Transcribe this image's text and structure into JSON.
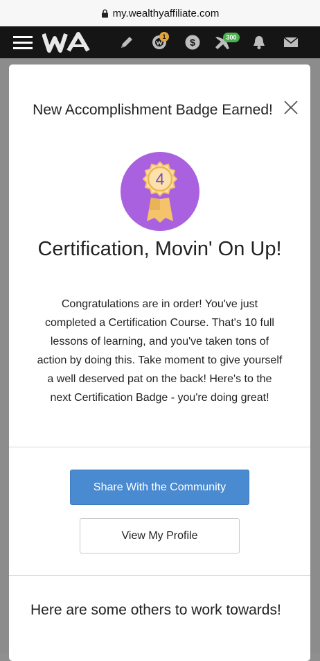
{
  "browser": {
    "url": "my.wealthyaffiliate.com"
  },
  "nav": {
    "logo_text": "WA",
    "notifications_count": "1",
    "messages_count": "300"
  },
  "modal": {
    "title": "New Accomplishment Badge Earned!",
    "badge_number": "4",
    "achievement_title": "Certification, Movin' On Up!",
    "description": "Congratulations are in order! You've just completed a Certification Course. That's 10 full lessons of learning, and you've taken tons of action by doing this. Take moment to give yourself a well deserved pat on the back! Here's to the next Certification Badge - you're doing great!",
    "share_label": "Share With the Community",
    "profile_label": "View My Profile",
    "others_heading": "Here are some others to work towards!"
  },
  "colors": {
    "medal_bg": "#a961e0",
    "medal_gold": "#f5c36a",
    "share_button": "#4a8ad0",
    "navbar": "#151515"
  },
  "icons": [
    "lock-icon",
    "menu-icon",
    "pencil-icon",
    "dollar-icon",
    "plane-icon",
    "bell-icon",
    "mail-icon",
    "close-icon",
    "medal-icon"
  ]
}
